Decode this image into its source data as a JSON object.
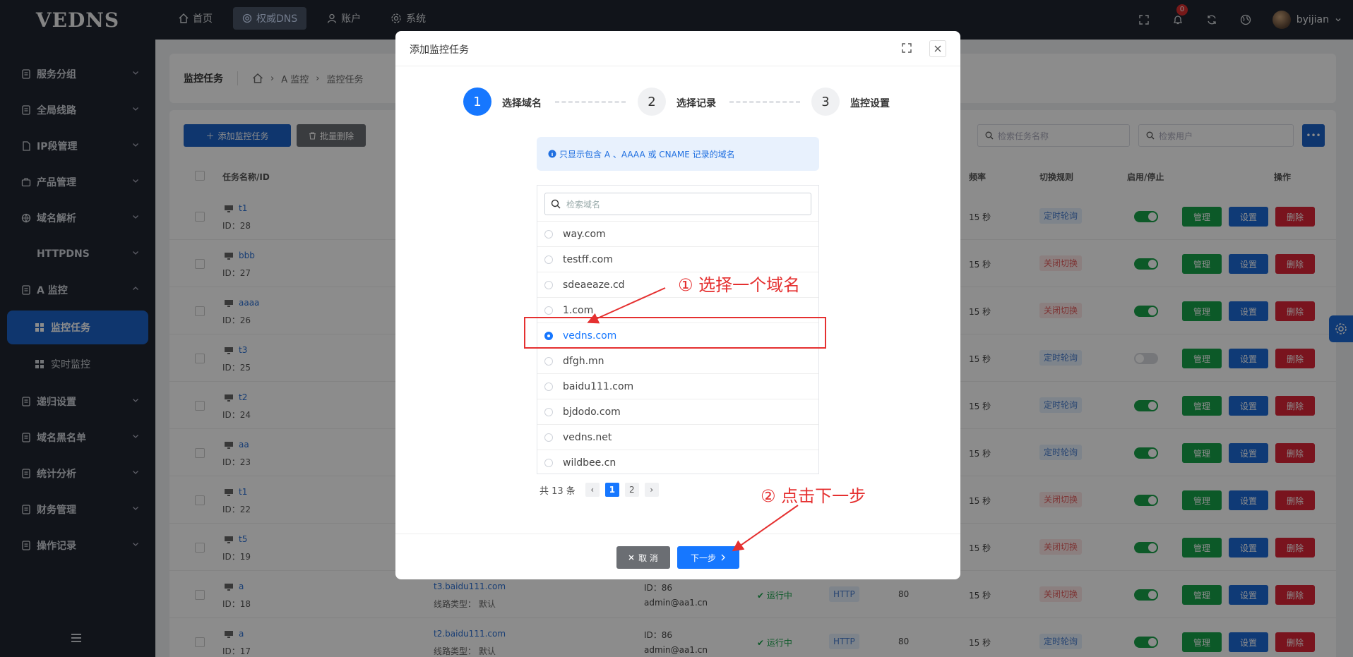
{
  "app": {
    "logo": "VEDNS"
  },
  "topnav": [
    {
      "label": "首页",
      "icon": "home-icon"
    },
    {
      "label": "权威DNS",
      "icon": "globe-icon",
      "active": true
    },
    {
      "label": "账户",
      "icon": "user-icon"
    },
    {
      "label": "系统",
      "icon": "gear-icon"
    }
  ],
  "topright": {
    "notification_count": "0",
    "username": "byijian"
  },
  "sidebar": {
    "items": [
      {
        "label": "服务分组"
      },
      {
        "label": "全局线路"
      },
      {
        "label": "IP段管理"
      },
      {
        "label": "产品管理"
      },
      {
        "label": "域名解析"
      },
      {
        "label": "HTTPDNS"
      },
      {
        "label": "A 监控"
      },
      {
        "label": "递归设置"
      },
      {
        "label": "域名黑名单"
      },
      {
        "label": "统计分析"
      },
      {
        "label": "财务管理"
      },
      {
        "label": "操作记录"
      }
    ],
    "subitems": [
      {
        "label": "监控任务",
        "active": true
      },
      {
        "label": "实时监控"
      }
    ]
  },
  "page": {
    "title": "监控任务",
    "breadcrumb": [
      "A 监控",
      "监控任务"
    ],
    "add_button": "添加监控任务",
    "batch_delete_button": "批量删除",
    "search_task_placeholder": "检索任务名称",
    "search_user_placeholder": "检索用户",
    "columns": {
      "name": "任务名称/ID",
      "freq": "频率",
      "switch_rule": "切换规则",
      "enable": "启用/停止",
      "ops": "操作"
    },
    "actions": {
      "manage": "管理",
      "settings": "设置",
      "delete": "删除"
    },
    "rows": [
      {
        "name": "t1",
        "id": "ID：28",
        "freq": "15 秒",
        "rule": "定时轮询",
        "rule_color": "blue",
        "enabled": true
      },
      {
        "name": "bbb",
        "id": "ID：27",
        "freq": "15 秒",
        "rule": "关闭切换",
        "rule_color": "red",
        "enabled": true
      },
      {
        "name": "aaaa",
        "id": "ID：26",
        "freq": "15 秒",
        "rule": "关闭切换",
        "rule_color": "red",
        "enabled": true
      },
      {
        "name": "t3",
        "id": "ID：25",
        "freq": "15 秒",
        "rule": "定时轮询",
        "rule_color": "blue",
        "enabled": false
      },
      {
        "name": "t2",
        "id": "ID：24",
        "freq": "15 秒",
        "rule": "定时轮询",
        "rule_color": "blue",
        "enabled": true
      },
      {
        "name": "aa",
        "id": "ID：23",
        "freq": "15 秒",
        "rule": "定时轮询",
        "rule_color": "blue",
        "enabled": true
      },
      {
        "name": "t1",
        "id": "ID：22",
        "freq": "15 秒",
        "rule": "关闭切换",
        "rule_color": "red",
        "enabled": true
      },
      {
        "name": "t5",
        "id": "ID：19",
        "freq": "15 秒",
        "rule": "关闭切换",
        "rule_color": "red",
        "enabled": true
      },
      {
        "name": "a",
        "id": "ID：18",
        "freq": "15 秒",
        "rule": "关闭切换",
        "rule_color": "red",
        "enabled": true,
        "domain": "t3.baidu111.com",
        "line_type": "线路类型： 默认",
        "owner_id": "ID：86",
        "owner": "admin@aa1.cn",
        "status": "运行中",
        "protocol": "HTTP",
        "port": "80"
      },
      {
        "name": "a",
        "id": "ID：17",
        "freq": "15 秒",
        "rule": "定时轮询",
        "rule_color": "blue",
        "enabled": true,
        "domain": "t2.baidu111.com",
        "line_type": "线路类型： 默认",
        "owner_id": "ID：86",
        "owner": "admin@aa1.cn",
        "status": "运行中",
        "protocol": "HTTP",
        "port": "80"
      }
    ]
  },
  "modal": {
    "title": "添加监控任务",
    "steps": [
      {
        "num": "1",
        "label": "选择域名"
      },
      {
        "num": "2",
        "label": "选择记录"
      },
      {
        "num": "3",
        "label": "监控设置"
      }
    ],
    "info": "只显示包含 A 、AAAA 或 CNAME 记录的域名",
    "search_placeholder": "检索域名",
    "domains": [
      "way.com",
      "testff.com",
      "sdeaeaze.cd",
      "1.com",
      "vedns.com",
      "dfgh.mn",
      "baidu111.com",
      "bjdodo.com",
      "vedns.net",
      "wildbee.cn"
    ],
    "selected_index": 4,
    "total": "共 13 条",
    "pages": [
      "1",
      "2"
    ],
    "cancel": "取 消",
    "next": "下一步"
  },
  "annotations": {
    "one": "① 选择一个域名",
    "two": "② 点击下一步"
  },
  "colors": {
    "primary": "#1677ff",
    "annotation": "#e53030",
    "sidebar_bg": "#1f2530",
    "manage": "#16a34a",
    "settings": "#1d6ad8",
    "delete": "#dc2638"
  }
}
